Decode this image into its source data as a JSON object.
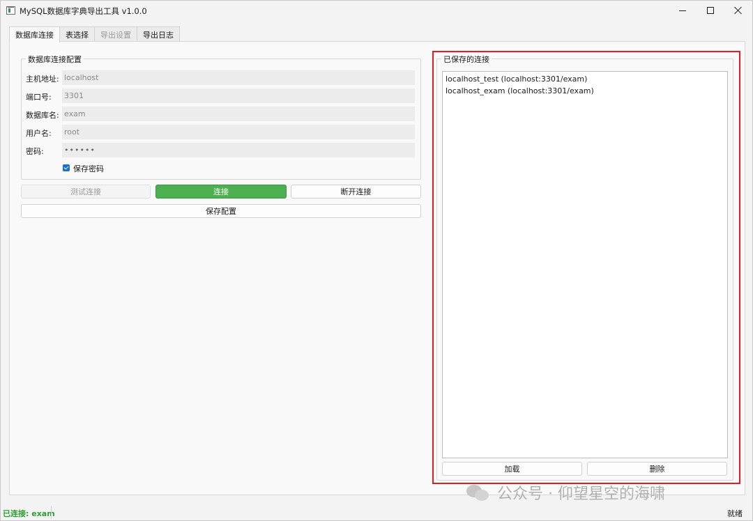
{
  "window": {
    "title": "MySQL数据库字典导出工具 v1.0.0"
  },
  "tabs": [
    {
      "label": "数据库连接",
      "active": true,
      "enabled": true
    },
    {
      "label": "表选择",
      "active": false,
      "enabled": true
    },
    {
      "label": "导出设置",
      "active": false,
      "enabled": false
    },
    {
      "label": "导出日志",
      "active": false,
      "enabled": true
    }
  ],
  "connection_group": {
    "title": "数据库连接配置",
    "host_label": "主机地址:",
    "host_value": "localhost",
    "port_label": "端口号:",
    "port_value": "3301",
    "db_label": "数据库名:",
    "db_value": "exam",
    "user_label": "用户名:",
    "user_value": "root",
    "password_label": "密码:",
    "password_value": "••••••",
    "save_password_label": "保存密码",
    "save_password_checked": true
  },
  "buttons": {
    "test": "测试连接",
    "connect": "连接",
    "disconnect": "断开连接",
    "save_config": "保存配置",
    "load": "加载",
    "delete": "删除"
  },
  "saved": {
    "title": "已保存的连接",
    "items": [
      "localhost_test (localhost:3301/exam)",
      "localhost_exam (localhost:3301/exam)"
    ]
  },
  "watermark": "公众号 · 仰望星空的海啸",
  "status": {
    "left": "已连接: exam",
    "right": "就绪"
  },
  "colors": {
    "connect_button": "#4caf50",
    "status_connected": "#2f9e35",
    "highlight_border": "#e02020",
    "checkbox": "#1a6fc9"
  }
}
